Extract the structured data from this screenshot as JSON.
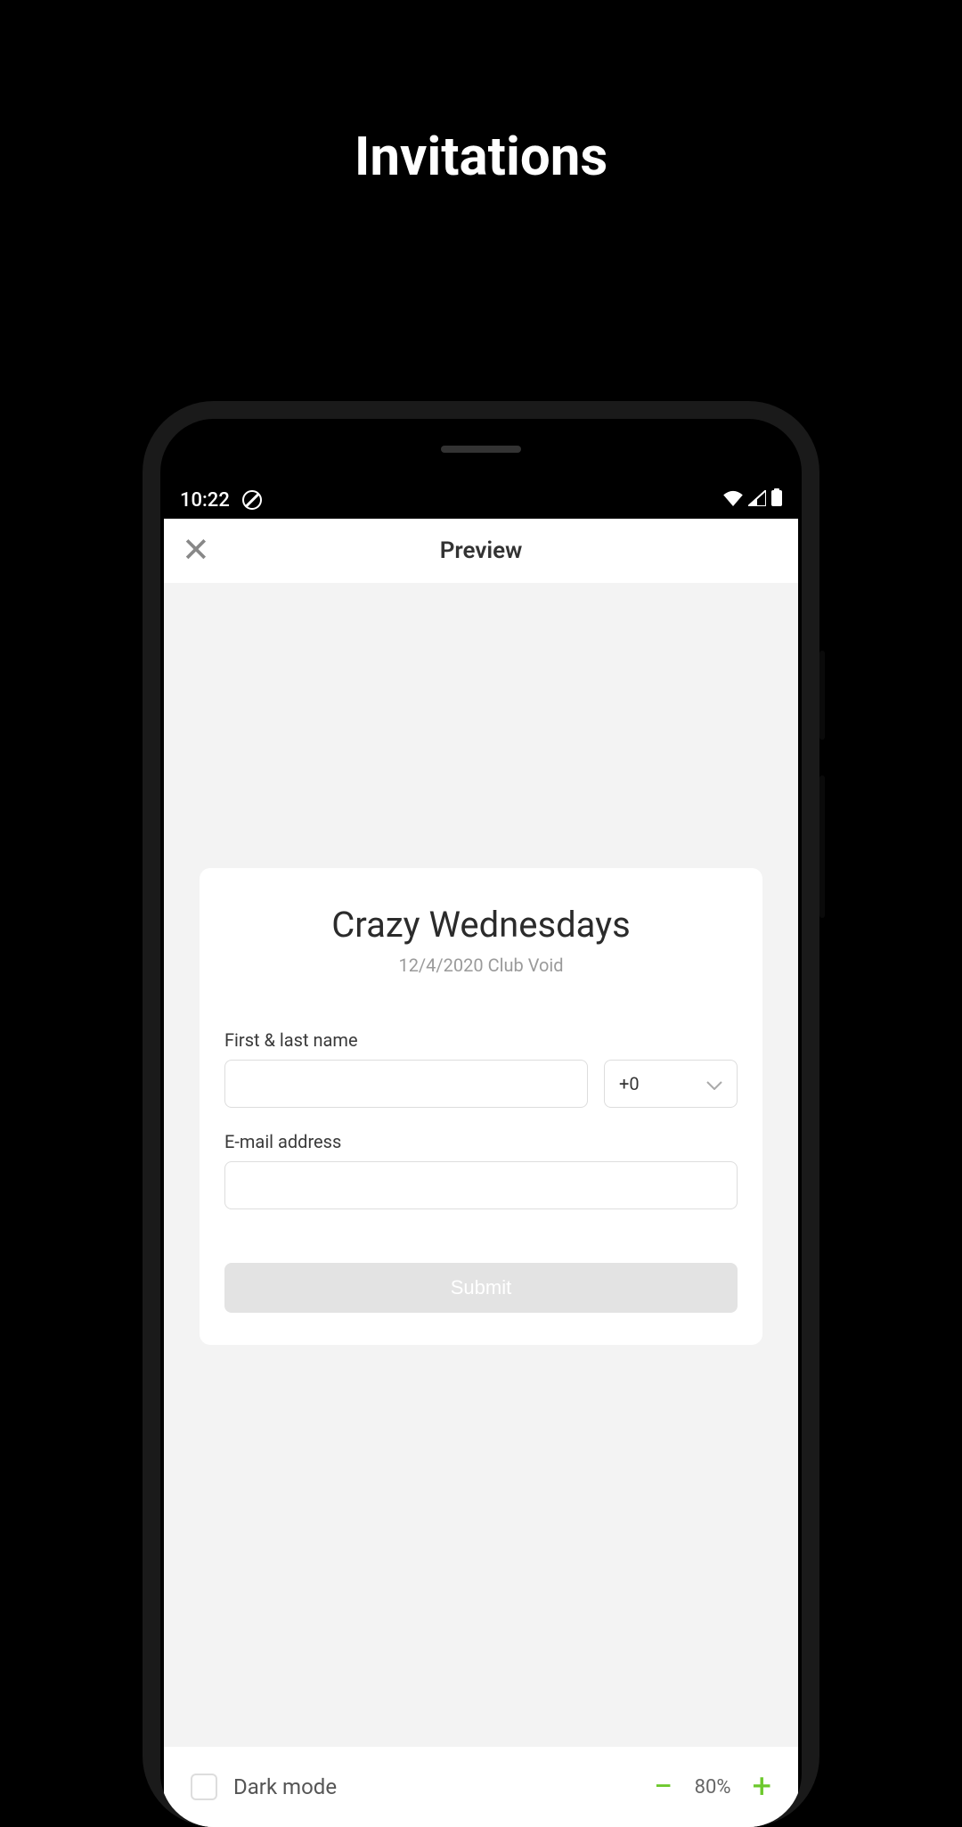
{
  "page": {
    "title": "Invitations"
  },
  "statusbar": {
    "time": "10:22"
  },
  "header": {
    "title": "Preview"
  },
  "event": {
    "title": "Crazy Wednesdays",
    "subtitle": "12/4/2020 Club Void"
  },
  "form": {
    "name_label": "First & last name",
    "name_value": "",
    "guests_value": "+0",
    "email_label": "E-mail address",
    "email_value": "",
    "submit_label": "Submit"
  },
  "footer": {
    "darkmode_label": "Dark mode",
    "zoom_value": "80%"
  }
}
